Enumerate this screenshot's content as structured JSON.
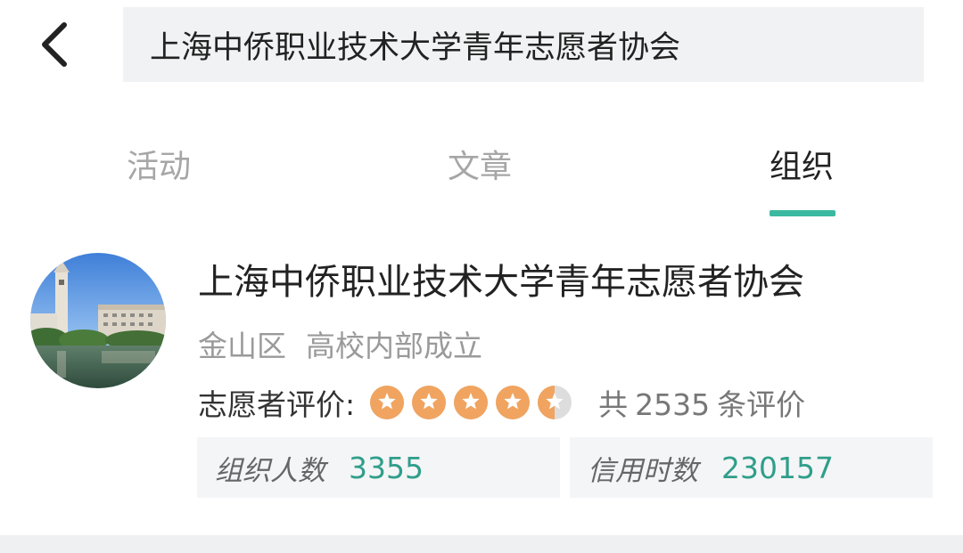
{
  "header": {
    "search_value": "上海中侨职业技术大学青年志愿者协会"
  },
  "tabs": [
    {
      "label": "活动",
      "active": false
    },
    {
      "label": "文章",
      "active": false
    },
    {
      "label": "组织",
      "active": true
    }
  ],
  "organization": {
    "name": "上海中侨职业技术大学青年志愿者协会",
    "district": "金山区",
    "type": "高校内部成立",
    "rating_label": "志愿者评价:",
    "rating_value": 4.5,
    "rating_max": 5,
    "review_prefix": "共",
    "review_count": "2535",
    "review_suffix": "条评价",
    "stats": [
      {
        "label": "组织人数",
        "value": "3355"
      },
      {
        "label": "信用时数",
        "value": "230157"
      }
    ]
  },
  "colors": {
    "accent": "#3bb9a0",
    "stat_value": "#2f9e8a",
    "star": "#f0a460"
  },
  "icons": {
    "back": "chevron-left-icon",
    "star": "star-icon"
  }
}
